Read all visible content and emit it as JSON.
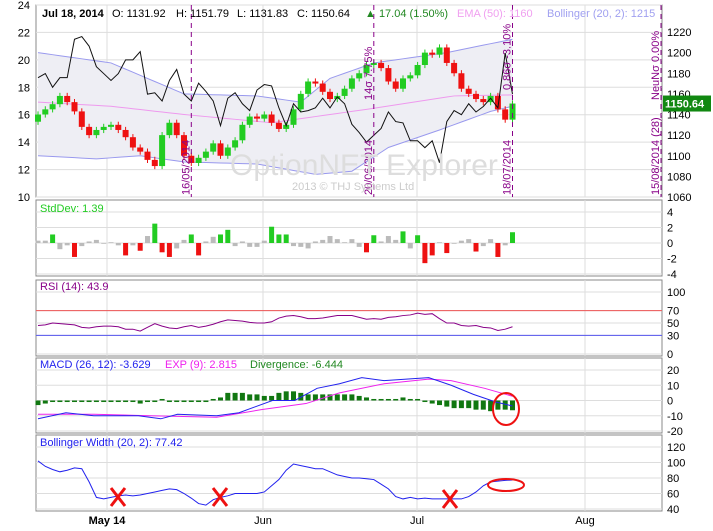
{
  "header": {
    "date": "Jul 18, 2014",
    "open": "O: 1131.92",
    "high": "H: 1151.79",
    "low": "L: 1131.83",
    "close": "C: 1150.64",
    "change": "▲ 17.04 (1.50%)",
    "ema": "EMA (50): 1160",
    "bollinger": "Bollinger (20, 2): 1215"
  },
  "watermark": {
    "title": "OptionNET Explorer",
    "copyright": "2013 © THJ Systems Ltd"
  },
  "colors": {
    "up": "#22cc22",
    "down": "#ee1111",
    "neutral": "#bbbbbb",
    "band": "#9999ee",
    "ema": "#ee99ee",
    "marker": "#880088",
    "annotation": "#ee1111"
  },
  "chart_data": [
    {
      "type": "candlestick",
      "panel": "price",
      "left_axis": {
        "ticks": [
          "24",
          "22",
          "20",
          "18",
          "16",
          "14",
          "12",
          "10"
        ],
        "range": [
          10,
          24
        ]
      },
      "right_axis": {
        "ticks": [
          "1220",
          "1200",
          "1180",
          "1160",
          "1140",
          "1120",
          "1100",
          "1080",
          "1060"
        ],
        "range": [
          1060,
          1220
        ]
      },
      "last_price_label": "1150.64",
      "closes": [
        1140,
        1145,
        1150,
        1158,
        1152,
        1143,
        1128,
        1120,
        1125,
        1128,
        1130,
        1125,
        1118,
        1108,
        1104,
        1096,
        1090,
        1120,
        1132,
        1120,
        1100,
        1093,
        1098,
        1104,
        1112,
        1100,
        1108,
        1115,
        1130,
        1138,
        1136,
        1140,
        1132,
        1126,
        1130,
        1145,
        1160,
        1172,
        1170,
        1162,
        1155,
        1158,
        1165,
        1175,
        1180,
        1188,
        1190,
        1185,
        1172,
        1165,
        1175,
        1178,
        1188,
        1200,
        1198,
        1205,
        1190,
        1180,
        1165,
        1160,
        1155,
        1152,
        1158,
        1145,
        1135,
        1150.64
      ],
      "first_open": 1133,
      "volatility_line": [
        18.7,
        19,
        18,
        18.7,
        18.7,
        21.5,
        21.7,
        21,
        19.5,
        19,
        18.5,
        19,
        20,
        20,
        20.6,
        17.5,
        17.6,
        17,
        18.5,
        19.3,
        17.5,
        17,
        18.3,
        17.7,
        17,
        15.2,
        17.2,
        17.6,
        16.8,
        16.3,
        17.8,
        18.2,
        18.1,
        16.5,
        15.2,
        16.8,
        16.2,
        16.3,
        16.5,
        17.2,
        16.5,
        17.3,
        16.8,
        15.3,
        14.7,
        14,
        14.5,
        15,
        16.2,
        15.5,
        15.4,
        14.1,
        14.1,
        13.6,
        14.1,
        12.5,
        15.5,
        16.3,
        16,
        16.8,
        16.2,
        16.6,
        17.2,
        16.5,
        20.5,
        17.5
      ],
      "bollinger_upper": [
        [
          0,
          1200
        ],
        [
          10,
          1190
        ],
        [
          20,
          1160
        ],
        [
          30,
          1158
        ],
        [
          36,
          1152
        ],
        [
          40,
          1175
        ],
        [
          46,
          1190
        ],
        [
          56,
          1200
        ],
        [
          65,
          1213
        ]
      ],
      "bollinger_lower": [
        [
          0,
          1100
        ],
        [
          8,
          1097
        ],
        [
          14,
          1100
        ],
        [
          20,
          1094
        ],
        [
          30,
          1092
        ],
        [
          38,
          1082
        ],
        [
          43,
          1085
        ],
        [
          48,
          1108
        ],
        [
          55,
          1125
        ],
        [
          62,
          1143
        ],
        [
          65,
          1148
        ]
      ],
      "ema": [
        [
          0,
          1152
        ],
        [
          10,
          1148
        ],
        [
          20,
          1140
        ],
        [
          32,
          1132
        ],
        [
          45,
          1145
        ],
        [
          57,
          1158
        ],
        [
          65,
          1159
        ]
      ],
      "markers": [
        {
          "index": 21,
          "label": "16/05/2014"
        },
        {
          "index": 46,
          "label": "20/06/2014",
          "top": "14σ 7.75%"
        },
        {
          "index": 65,
          "label": "18/07/2014",
          "top": "0.86σ -3.10%"
        },
        {
          "index": 86,
          "label": "15/08/2014 (28)",
          "top": "NeuNσ 0.00%"
        }
      ]
    },
    {
      "type": "bar",
      "panel": "stddev",
      "title": "StdDev: 1.39",
      "ticks": [
        "4",
        "2",
        "0",
        "-2",
        "-4"
      ],
      "range": [
        -4,
        4
      ],
      "values": [
        0.3,
        0.3,
        1.1,
        -0.8,
        -0.3,
        -1.8,
        -0.4,
        0.2,
        0.4,
        -0.1,
        0.1,
        -0.3,
        -1.6,
        -0.3,
        -1,
        0.9,
        2.5,
        -1.2,
        -1.8,
        -0.7,
        0.4,
        1.1,
        -1.6,
        0.2,
        0.8,
        1.1,
        1.7,
        -0.4,
        0.2,
        -0.5,
        -0.5,
        0.3,
        2.1,
        1.1,
        1.1,
        -0.4,
        -0.5,
        -0.7,
        0.2,
        0.4,
        0.9,
        0.5,
        0.1,
        0.5,
        -0.5,
        -1.2,
        1,
        0.2,
        0.9,
        0.4,
        1.5,
        -0.7,
        1,
        -2.6,
        -1.6,
        0.1,
        -1.3,
        -0.1,
        0.3,
        0.5,
        -1.1,
        -0.4,
        0.5,
        -1.8,
        -0.3,
        1.39
      ]
    },
    {
      "type": "line",
      "panel": "rsi",
      "title": "RSI (14): 43.9",
      "ticks": [
        "100",
        "70",
        "50",
        "30",
        "0"
      ],
      "range": [
        0,
        100
      ],
      "levels": [
        70,
        30
      ],
      "values": [
        46,
        47,
        50,
        49,
        48,
        47,
        43,
        42,
        44,
        45,
        45,
        44,
        40,
        40,
        37,
        43,
        49,
        45,
        42,
        41,
        44,
        46,
        43,
        45,
        48,
        52,
        55,
        54,
        53,
        51,
        50,
        50,
        52,
        58,
        61,
        62,
        60,
        57,
        57,
        58,
        60,
        62,
        62,
        62,
        59,
        56,
        57,
        56,
        59,
        60,
        62,
        63,
        66,
        64,
        65,
        57,
        50,
        50,
        46,
        45,
        46,
        43,
        42,
        38,
        40,
        43.9
      ]
    },
    {
      "type": "line",
      "panel": "macd",
      "title": "MACD (26, 12): -3.629",
      "signal_title": "EXP (9): 2.815",
      "divergence_title": "Divergence: -6.444",
      "ticks": [
        "20",
        "10",
        "0",
        "-10",
        "-20"
      ],
      "range": [
        -20,
        20
      ],
      "macd": [
        [
          0,
          -12
        ],
        [
          5,
          -8
        ],
        [
          10,
          -10
        ],
        [
          18,
          -10
        ],
        [
          22,
          -12
        ],
        [
          25,
          -9
        ],
        [
          32,
          -10
        ],
        [
          36,
          -8
        ],
        [
          42,
          0
        ],
        [
          46,
          0
        ],
        [
          50,
          8
        ],
        [
          54,
          11
        ],
        [
          58,
          15
        ],
        [
          62,
          13
        ],
        [
          66,
          14
        ],
        [
          70,
          15
        ],
        [
          74,
          10
        ],
        [
          78,
          4
        ],
        [
          82,
          -1
        ],
        [
          85,
          -3.6
        ]
      ],
      "signal": [
        [
          0,
          -9
        ],
        [
          10,
          -9
        ],
        [
          20,
          -10
        ],
        [
          32,
          -11
        ],
        [
          40,
          -6
        ],
        [
          48,
          -2
        ],
        [
          54,
          5
        ],
        [
          62,
          11
        ],
        [
          70,
          14
        ],
        [
          74,
          13
        ],
        [
          80,
          8
        ],
        [
          85,
          2.8
        ]
      ],
      "divergence": [
        -3,
        -2,
        -1,
        -1,
        -1,
        -1,
        -1,
        -1,
        -1,
        -1,
        -1,
        -1,
        -1,
        -1,
        -2,
        -1,
        -1,
        1,
        -1,
        -1,
        -1,
        -1,
        -1,
        -1,
        1,
        2,
        5,
        5,
        5,
        4,
        4,
        3,
        3,
        5,
        6,
        6,
        5,
        4,
        4,
        4,
        4,
        4,
        4,
        4,
        3,
        2,
        1,
        1,
        1,
        1,
        2,
        1,
        1,
        -1,
        -2,
        -3,
        -4,
        -5,
        -5,
        -5,
        -6,
        -6,
        -7,
        -6,
        -6,
        -6.4
      ]
    },
    {
      "type": "line",
      "panel": "bollinger_width",
      "title": "Bollinger Width (20, 2): 77.42",
      "ticks": [
        "120",
        "100",
        "80",
        "60",
        "40"
      ],
      "range": [
        40,
        120
      ],
      "values": [
        102,
        95,
        91,
        88,
        90,
        93,
        92,
        75,
        55,
        53,
        55,
        57,
        58,
        57,
        58,
        60,
        62,
        64,
        66,
        65,
        60,
        54,
        47,
        45,
        52,
        55,
        57,
        60,
        60,
        60,
        60,
        62,
        70,
        78,
        90,
        98,
        96,
        94,
        92,
        92,
        88,
        84,
        82,
        80,
        80,
        79,
        78,
        72,
        66,
        56,
        53,
        55,
        53,
        54,
        53,
        53,
        53,
        53,
        53,
        56,
        62,
        70,
        75,
        76,
        77,
        77.42
      ]
    }
  ],
  "x_axis": {
    "labels": [
      "May 14",
      "Jun",
      "Jul",
      "Aug"
    ]
  }
}
